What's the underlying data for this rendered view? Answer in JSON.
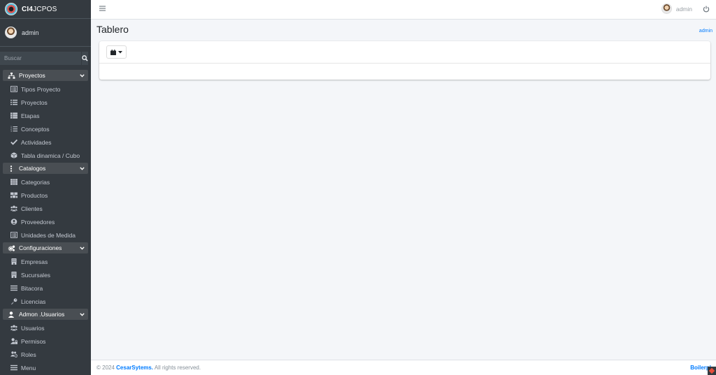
{
  "brand": {
    "name_bold": "CI4",
    "name_light": "JCPOS"
  },
  "user": {
    "name": "admin"
  },
  "search": {
    "placeholder": "Buscar"
  },
  "sidebar": {
    "sections": [
      {
        "label": "Proyectos",
        "icon": "sitemap-icon",
        "items": [
          {
            "label": "Tipos Proyecto",
            "icon": "list-alt-icon"
          },
          {
            "label": "Proyectos",
            "icon": "list-icon"
          },
          {
            "label": "Etapas",
            "icon": "th-list-icon"
          },
          {
            "label": "Conceptos",
            "icon": "list-ol-icon"
          },
          {
            "label": "Actividades",
            "icon": "check-icon"
          },
          {
            "label": "Tabla dinamica / Cubo",
            "icon": "cube-icon"
          }
        ]
      },
      {
        "label": "Catalogos",
        "icon": "ellipsis-v-icon",
        "items": [
          {
            "label": "Categorias",
            "icon": "th-icon"
          },
          {
            "label": "Productos",
            "icon": "boxes-icon"
          },
          {
            "label": "Clientes",
            "icon": "users-icon"
          },
          {
            "label": "Proveedores",
            "icon": "user-circle-icon"
          },
          {
            "label": "Unidades de Medida",
            "icon": "list-alt-icon"
          }
        ]
      },
      {
        "label": "Configuraciones",
        "icon": "cogs-icon",
        "items": [
          {
            "label": "Empresas",
            "icon": "building-icon"
          },
          {
            "label": "Sucursales",
            "icon": "building-icon"
          },
          {
            "label": "Bitacora",
            "icon": "bars-icon"
          },
          {
            "label": "Licencias",
            "icon": "key-icon"
          }
        ]
      },
      {
        "label": "Admon .Usuarios",
        "icon": "user-icon",
        "items": [
          {
            "label": "Usuarios",
            "icon": "users-icon"
          },
          {
            "label": "Permisos",
            "icon": "user-lock-icon"
          },
          {
            "label": "Roles",
            "icon": "users-cog-icon"
          },
          {
            "label": "Menu",
            "icon": "bars-icon"
          }
        ]
      }
    ]
  },
  "topbar": {
    "user_name": "admin"
  },
  "page": {
    "title": "Tablero",
    "breadcrumb": "admin"
  },
  "footer": {
    "copyright_prefix": "© 2024 ",
    "company": "CesarSytems.",
    "suffix": " All rights reserved.",
    "right_text": "Boilerpl"
  },
  "colors": {
    "sidebar_bg": "#343a40",
    "accent": "#007bff",
    "page_bg": "#f4f6f9"
  }
}
